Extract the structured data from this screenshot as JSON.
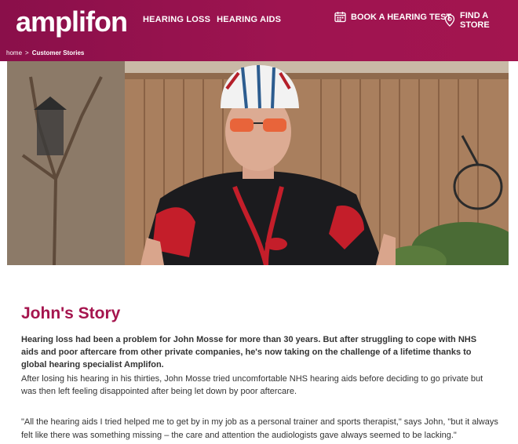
{
  "header": {
    "logo_text": "amplifon",
    "nav": [
      "HEARING LOSS",
      "HEARING AIDS"
    ],
    "book_test": "BOOK A HEARING TEST",
    "find_store": "FIND A STORE",
    "calendar_icon": "calendar-icon",
    "location_icon": "location-pin-icon",
    "brand_color": "#9e1450"
  },
  "breadcrumb": {
    "home": "home",
    "separator": ">",
    "current": "Customer Stories"
  },
  "hero": {
    "image": "cyclist-in-garden-photo"
  },
  "article": {
    "title": "John's Story",
    "lead": "Hearing loss had been a problem for John Mosse for more than 30 years. But after struggling to cope with NHS aids and poor aftercare from other private companies, he's now taking on the challenge of a lifetime thanks to global hearing specialist Amplifon.",
    "para1": "After losing his hearing in his thirties, John Mosse tried uncomfortable NHS hearing aids before deciding to go private but was then left feeling disappointed after being let down by poor aftercare.",
    "quote": "\"All the hearing aids I tried helped me to get by in my job as a personal trainer and sports therapist,\" says John, \"but it always felt like there was something missing – the care and attention the audiologists gave always seemed to be lacking.\""
  }
}
